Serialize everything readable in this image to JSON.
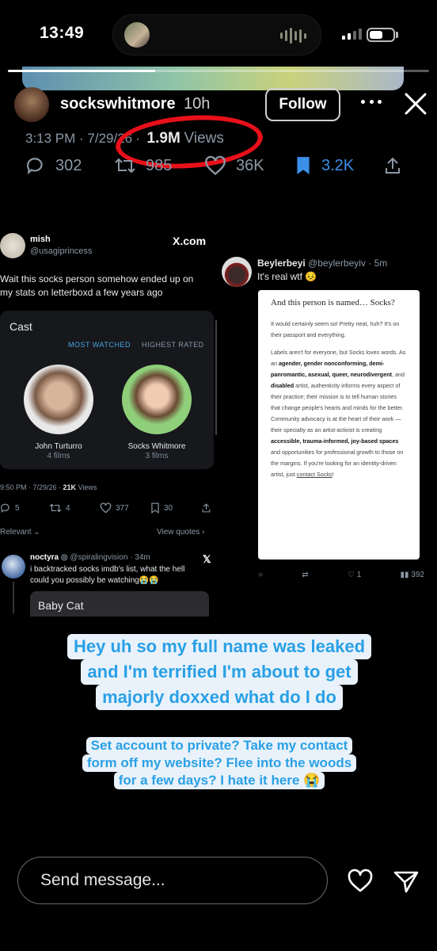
{
  "status_bar": {
    "time": "13:49"
  },
  "story": {
    "progress": 0.35,
    "username": "sockswhitmore",
    "time_ago": "10h",
    "follow_label": "Follow"
  },
  "tweet_meta": {
    "time_date": "3:13 PM · 7/29/26",
    "views_count": "1.9M",
    "views_label": "Views",
    "replies": "302",
    "reposts": "985",
    "likes": "36K",
    "bookmarks": "3.2K"
  },
  "left_tweet": {
    "name": "mish",
    "handle": "@usagiprincess",
    "platform": "X.com",
    "text": "Wait this socks person somehow ended up on my stats on letterboxd a few years ago",
    "cast_title": "Cast",
    "tab_most_watched": "MOST WATCHED",
    "tab_highest_rated": "HIGHEST RATED",
    "cast": [
      {
        "name": "John Turturro",
        "films": "4 films"
      },
      {
        "name": "Socks Whitmore",
        "films": "3 films"
      }
    ],
    "timestamp": "9:50 PM · 7/29/26 · ",
    "views": "21K",
    "views_label": " Views",
    "stats": {
      "replies": "5",
      "reposts": "4",
      "likes": "377",
      "bookmarks": "30"
    },
    "relevant": "Relevant",
    "view_quotes": "View quotes",
    "reply": {
      "name": "noctyra",
      "handle": "@spiralingvision · 34m",
      "text": "i backtracked socks imdb's list, what the hell could you possibly be watching😭😭",
      "card_title": "Baby Cat"
    }
  },
  "right_tweet": {
    "name": "Beylerbeyi",
    "handle": "@beylerbeyiv · 5m",
    "text": "It's real wtf 😣",
    "doc_title": "And this person is named… Socks?",
    "doc_p1": "It would certainly seem so! Pretty neat, huh? It's on their passport and everything.",
    "doc_p2_a": "Labels aren't for everyone, but Socks loves words. As an ",
    "doc_p2_b": "agender, gender nonconforming, demi-panromantic, asexual, queer, neurodivergent",
    "doc_p2_c": ", and ",
    "doc_p2_d": "disabled",
    "doc_p2_e": " artist, authenticity informs every aspect of their practice; their mission is to tell human stories that change people's hearts and minds for the better. Community advocacy is at the heart of their work — their specialty as an artist-activist is creating ",
    "doc_p2_f": "accessible, trauma-informed, joy-based spaces",
    "doc_p2_g": " and opportunities for professional growth to those on the margins. If you're looking for an identity-driven artist, just ",
    "doc_link": "contact Socks",
    "doc_end": "!",
    "likes": "1",
    "views": "392"
  },
  "captions": {
    "line1": [
      "Hey uh so my full name was leaked",
      "and I'm terrified I'm about to get",
      "majorly doxxed what do I do"
    ],
    "line2": [
      "Set account to private? Take my contact",
      "form off my website? Flee into the woods",
      "for a few days? I hate it here 😭"
    ]
  },
  "bottom_bar": {
    "placeholder": "Send message..."
  },
  "colors": {
    "accent_blue": "#3a8fe8",
    "highlight_red": "#e8101a",
    "caption_text": "#2aa0e6",
    "caption_bg": "#e9f2fa"
  }
}
